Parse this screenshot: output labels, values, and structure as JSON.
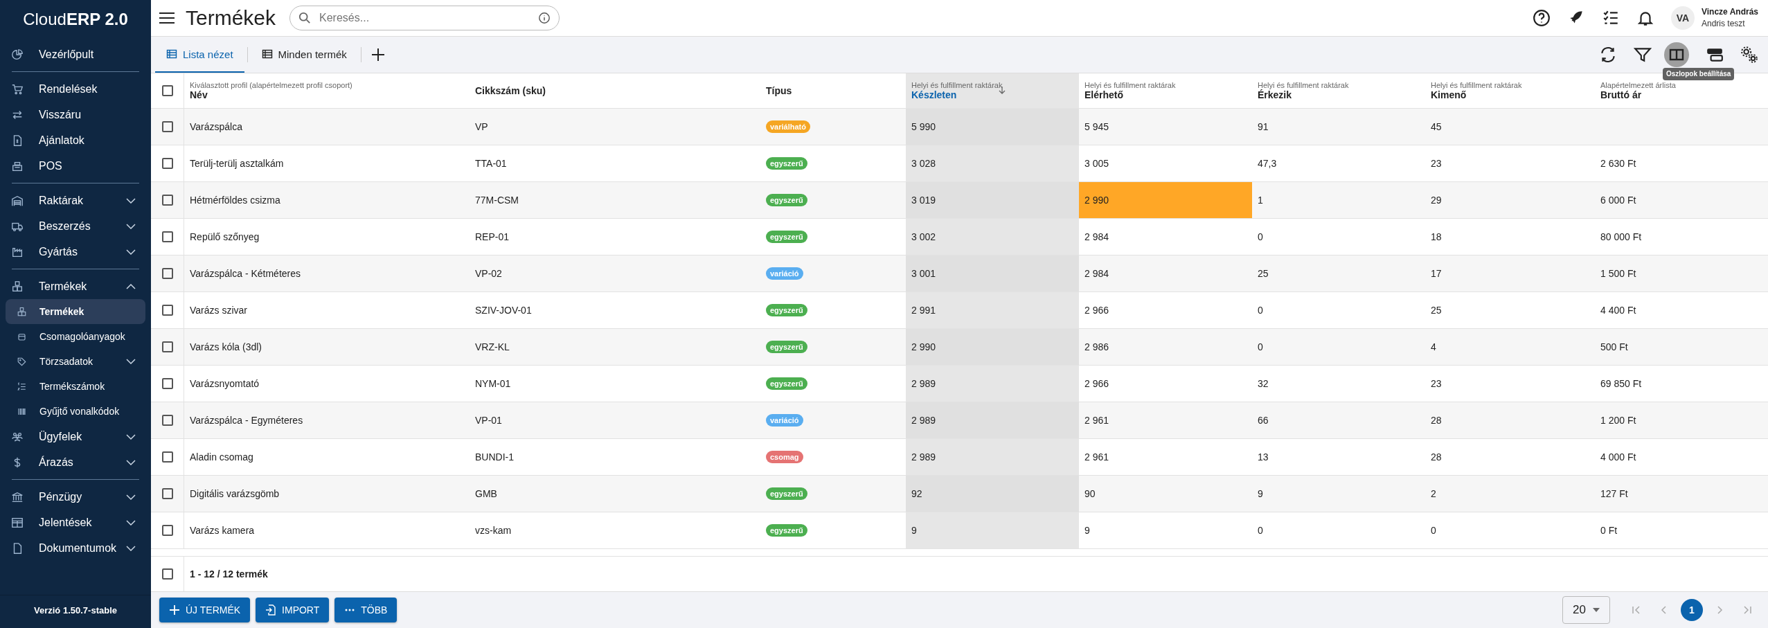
{
  "sidebar": {
    "logo": "Cloud**ERP 2.0**",
    "sections": [
      [
        {
          "label": "Vezérlőpult",
          "selected": false
        }
      ],
      [
        {
          "label": "Rendelések",
          "selected": false
        },
        {
          "label": "Visszáru",
          "selected": false
        },
        {
          "label": "Ajánlatok",
          "selected": false
        },
        {
          "label": "POS",
          "selected": false
        }
      ],
      [
        {
          "label": "Raktárak",
          "selected": false,
          "expanded": false
        },
        {
          "label": "Beszerzés",
          "selected": false,
          "expanded": false
        },
        {
          "label": "Gyártás",
          "selected": false,
          "expanded": false
        }
      ],
      [
        {
          "label": "Termékek",
          "selected": false,
          "expanded": true,
          "children": [
            {
              "label": "Termékek",
              "selected": true
            },
            {
              "label": "Csomagolóanyagok",
              "selected": false
            },
            {
              "label": "Törzsadatok",
              "selected": false,
              "expanded": false
            },
            {
              "label": "Termékszámok",
              "selected": false
            },
            {
              "label": "Gyűjtő vonalkódok",
              "selected": false
            }
          ]
        },
        {
          "label": "Ügyfelek",
          "selected": false,
          "expanded": false
        },
        {
          "label": "Árazás",
          "selected": false,
          "expanded": false
        }
      ],
      [
        {
          "label": "Pénzügy",
          "selected": false,
          "expanded": false
        },
        {
          "label": "Jelentések",
          "selected": false,
          "expanded": false
        },
        {
          "label": "Dokumentumok",
          "selected": false,
          "expanded": false
        }
      ]
    ],
    "version": "Verzió 1.50.7-stable"
  },
  "header": {
    "title": "Termékek",
    "search": {
      "placeholder": "Keresés..."
    },
    "user": {
      "initials": "VA",
      "name": "Vincze András",
      "subtitle": "Andris teszt"
    }
  },
  "tabs": [
    {
      "label": "Lista nézet",
      "selected": true
    },
    {
      "label": "Minden termék",
      "selected": false
    }
  ],
  "toolbar": {
    "tooltip": "Oszlopok beállítása"
  },
  "table": {
    "header_checked": false,
    "columns": [
      {
        "group": "Kiválasztott profil (alapértelmezett profil csoport)",
        "label": "Név",
        "sorted": false
      },
      {
        "label": "Cikkszám (sku)",
        "sorted": false
      },
      {
        "label": "Típus",
        "sorted": false
      },
      {
        "group": "Helyi és fulfillment raktárak",
        "label": "Készleten",
        "sorted": true
      },
      {
        "group": "Helyi és fulfillment raktárak",
        "label": "Elérhető",
        "sorted": false
      },
      {
        "group": "Helyi és fulfillment raktárak",
        "label": "Érkezik",
        "sorted": false
      },
      {
        "group": "Helyi és fulfillment raktárak",
        "label": "Kimenő",
        "sorted": false
      },
      {
        "group": "Alapértelmezett árlista",
        "label": "Bruttó ár",
        "sorted": false
      }
    ],
    "rows": [
      {
        "checked": false,
        "name": "Varázspálca",
        "sku": "VP",
        "type": {
          "label": "variálható",
          "color": "#f5a623"
        },
        "stock": "5 990",
        "available": {
          "text": "5 945",
          "highlighted": false
        },
        "incoming": "91",
        "outgoing": "45"
      },
      {
        "checked": false,
        "name": "Terülj-terülj asztalkám",
        "sku": "TTA-01",
        "type": {
          "label": "egyszerű",
          "color": "#4caf50"
        },
        "stock": "3 028",
        "available": {
          "text": "3 005",
          "highlighted": false
        },
        "incoming": "47,3",
        "outgoing": "23",
        "price": "2 630 Ft"
      },
      {
        "checked": false,
        "name": "Hétmérföldes csizma",
        "sku": "77M-CSM",
        "type": {
          "label": "egyszerű",
          "color": "#4caf50"
        },
        "stock": "3 019",
        "available": {
          "text": "2 990",
          "highlighted": true
        },
        "incoming": "1",
        "outgoing": "29",
        "price": "6 000 Ft"
      },
      {
        "checked": false,
        "name": "Repülő szőnyeg",
        "sku": "REP-01",
        "type": {
          "label": "egyszerű",
          "color": "#4caf50"
        },
        "stock": "3 002",
        "available": {
          "text": "2 984",
          "highlighted": false
        },
        "incoming": "0",
        "outgoing": "18",
        "price": "80 000 Ft"
      },
      {
        "checked": false,
        "name": "Varázspálca - Kétméteres",
        "sku": "VP-02",
        "type": {
          "label": "variáció",
          "color": "#5aaef0"
        },
        "stock": "3 001",
        "available": {
          "text": "2 984",
          "highlighted": false
        },
        "incoming": "25",
        "outgoing": "17",
        "price": "1 500 Ft"
      },
      {
        "checked": false,
        "name": "Varázs szivar",
        "sku": "SZIV-JOV-01",
        "type": {
          "label": "egyszerű",
          "color": "#4caf50"
        },
        "stock": "2 991",
        "available": {
          "text": "2 966",
          "highlighted": false
        },
        "incoming": "0",
        "outgoing": "25",
        "price": "4 400 Ft"
      },
      {
        "checked": false,
        "name": "Varázs kóla (3dl)",
        "sku": "VRZ-KL",
        "type": {
          "label": "egyszerű",
          "color": "#4caf50"
        },
        "stock": "2 990",
        "available": {
          "text": "2 986",
          "highlighted": false
        },
        "incoming": "0",
        "outgoing": "4",
        "price": "500 Ft"
      },
      {
        "checked": false,
        "name": "Varázsnyomtató",
        "sku": "NYM-01",
        "type": {
          "label": "egyszerű",
          "color": "#4caf50"
        },
        "stock": "2 989",
        "available": {
          "text": "2 966",
          "highlighted": false
        },
        "incoming": "32",
        "outgoing": "23",
        "price": "69 850 Ft"
      },
      {
        "checked": false,
        "name": "Varázspálca - Egyméteres",
        "sku": "VP-01",
        "type": {
          "label": "variáció",
          "color": "#5aaef0"
        },
        "stock": "2 989",
        "available": {
          "text": "2 961",
          "highlighted": false
        },
        "incoming": "66",
        "outgoing": "28",
        "price": "1 200 Ft"
      },
      {
        "checked": false,
        "name": "Aladin csomag",
        "sku": "BUNDI-1",
        "type": {
          "label": "csomag",
          "color": "#e57373"
        },
        "stock": "2 989",
        "available": {
          "text": "2 961",
          "highlighted": false
        },
        "incoming": "13",
        "outgoing": "28",
        "price": "4 000 Ft"
      },
      {
        "checked": false,
        "name": "Digitális varázsgömb",
        "sku": "GMB",
        "type": {
          "label": "egyszerű",
          "color": "#4caf50"
        },
        "stock": "92",
        "available": {
          "text": "90",
          "highlighted": false
        },
        "incoming": "9",
        "outgoing": "2",
        "price": "127 Ft"
      },
      {
        "checked": false,
        "name": "Varázs kamera",
        "sku": "vzs-kam",
        "type": {
          "label": "egyszerű",
          "color": "#4caf50"
        },
        "stock": "9",
        "available": {
          "text": "9",
          "highlighted": false
        },
        "incoming": "0",
        "outgoing": "0",
        "price": "0 Ft"
      }
    ],
    "footer": {
      "checked": false,
      "summary": "1 - 12 / 12 termék"
    }
  },
  "actions": [
    {
      "label": "ÚJ TERMÉK"
    },
    {
      "label": "IMPORT"
    },
    {
      "label": "TÖBB"
    }
  ],
  "pagination": {
    "page_size": "20",
    "pages": [
      {
        "label": "1",
        "selected": true
      }
    ]
  }
}
